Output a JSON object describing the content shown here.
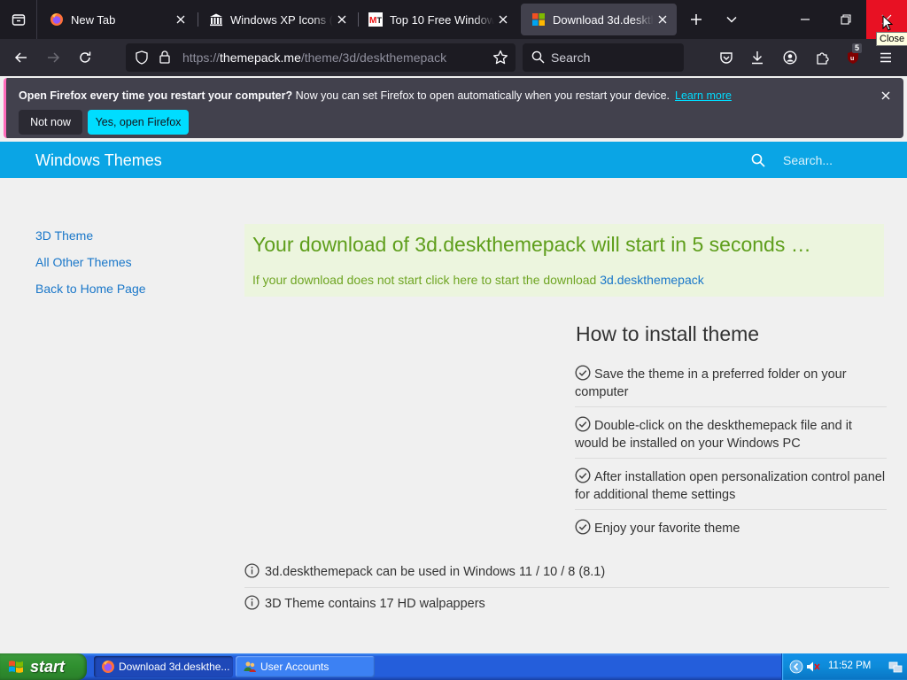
{
  "browser": {
    "tabs": [
      {
        "title": "New Tab",
        "active": false
      },
      {
        "title": "Windows XP Icons (.ico",
        "active": false
      },
      {
        "title": "Top 10 Free Windows 1",
        "active": false
      },
      {
        "title": "Download 3d.deskthem",
        "active": true
      }
    ],
    "tooltip": "Close",
    "url_prefix": "https://",
    "url_host": "themepack.me",
    "url_path": "/theme/3d/deskthemepack",
    "search_placeholder": "Search",
    "extension_badge": "5"
  },
  "notification": {
    "bold": "Open Firefox every time you restart your computer?",
    "text": " Now you can set Firefox to open automatically when you restart your device.",
    "learn_more": "Learn more",
    "not_now": "Not now",
    "open": "Yes, open Firefox"
  },
  "site": {
    "brand": "Windows Themes",
    "search_placeholder": "Search...",
    "sidebar": [
      "3D Theme",
      "All Other Themes",
      "Back to Home Page"
    ],
    "download_title": "Your download of 3d.deskthemepack will start in 5 seconds …",
    "download_sub": "If your download does not start click here to start the download",
    "download_link": "3d.deskthemepack",
    "install_title": "How to install theme",
    "steps": [
      "Save the theme in a preferred folder on your computer",
      "Double-click on the deskthemepack file and it would be installed on your Windows PC",
      "After installation open personalization control panel for additional theme settings",
      "Enjoy your favorite theme"
    ],
    "info": [
      "3d.deskthemepack can be used in Windows 11 / 10 / 8 (8.1)",
      "3D Theme contains 17 HD walpappers"
    ]
  },
  "taskbar": {
    "start": "start",
    "tasks": [
      "Download 3d.deskthe...",
      "User Accounts"
    ],
    "clock": "11:52 PM"
  },
  "colors": {
    "accent": "#0aa5e5",
    "download_green": "#5e9e1b",
    "link": "#1a77c9",
    "firefox_cta": "#00ddff"
  }
}
